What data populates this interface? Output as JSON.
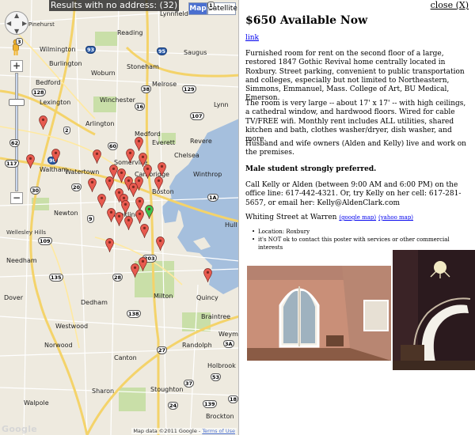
{
  "map": {
    "banner": "Results with no address: (32)",
    "map_button": "Map",
    "satellite_button": "Satellite",
    "zoom_in": "+",
    "zoom_out": "−",
    "pan_arrows": {
      "up": "▲",
      "down": "▼",
      "left": "◀",
      "right": "▶"
    },
    "attribution_text": "Map data ©2011 Google - ",
    "attribution_link": "Terms of Use",
    "google_logo": "Google",
    "accent_color": "#4a6fd0",
    "marker_color": "#e85a4f",
    "selected_marker_color": "#3cc44a",
    "places": [
      "Lynnfield",
      "Pinehurst",
      "Reading",
      "Saugus",
      "Wilmington",
      "Burlington",
      "Woburn",
      "Stoneham",
      "Bedford",
      "Melrose",
      "Lexington",
      "Winchester",
      "Lynn",
      "Arlington",
      "Medford",
      "Everett",
      "Revere",
      "Waltham",
      "Somerville",
      "Chelsea",
      "Watertown",
      "Cambridge",
      "Winthrop",
      "Newton",
      "Boston",
      "Brookline",
      "Wellesley Hills",
      "Hull",
      "Needham",
      "Dover",
      "Dedham",
      "Milton",
      "Quincy",
      "Westwood",
      "Braintree",
      "Weymouth",
      "Norwood",
      "Randolph",
      "Holbrook",
      "Canton",
      "Sharon",
      "Stoughton",
      "Walpole",
      "Brockton"
    ],
    "routes": [
      "1",
      "3",
      "93",
      "95",
      "128",
      "16",
      "2",
      "20",
      "9",
      "117",
      "60",
      "107",
      "28",
      "38",
      "62",
      "129",
      "30",
      "135",
      "109",
      "1A",
      "3A",
      "203",
      "138",
      "27",
      "37",
      "18",
      "139",
      "24",
      "53",
      "90"
    ]
  },
  "listing": {
    "close_label": "close (X)",
    "title": "$650 Available Now",
    "link_label": "link",
    "paragraph1": "Furnished room for rent on the second floor of a large, restored 1847 Gothic Revival home centrally located in Roxbury. Street parking, convenient to public transportation and colleges, especially but not limited to Northeastern, Simmons, Emmanuel, Mass. College of Art, BU Medical, Emerson.",
    "paragraph2": "The room is very large -- about 17' x 17' -- with high ceilings, a cathedral window, and hardwood floors. Wired for cable TV/FREE wifi. Monthly rent includes ALL utilities, shared kitchen and bath, clothes washer/dryer, dish washer, and more.",
    "paragraph3": "Husband and wife owners (Alden and Kelly) live and work on the premises.",
    "preference": "Male student strongly preferred.",
    "contact": "Call Kelly or Alden (between 9:00 AM and 6:00 PM) on the office line: 617-442-4321. Or, try Kelly on her cell: 617-281-5657, or email her: Kelly@AldenClark.com",
    "address": "Whiting Street at Warren",
    "google_map_link": "(google map)",
    "yahoo_map_link": "(yahoo map)",
    "facts": [
      "Location: Roxbury",
      "it's NOT ok to contact this poster with services or other commercial interests"
    ]
  }
}
